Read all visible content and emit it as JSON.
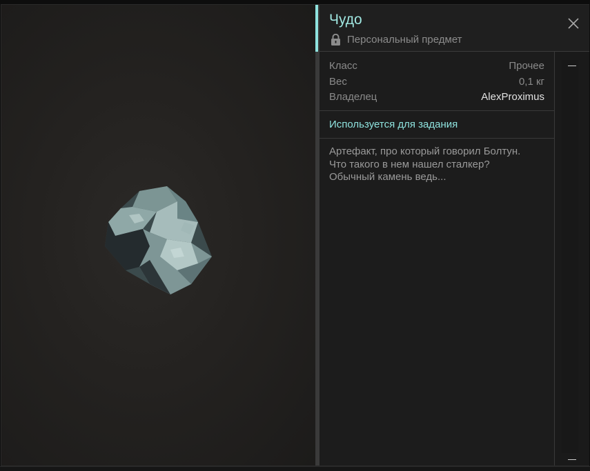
{
  "item": {
    "title": "Чудо",
    "subtitle": "Персональный предмет",
    "icon": "lock-icon"
  },
  "properties": [
    {
      "label": "Класс",
      "value": "Прочее"
    },
    {
      "label": "Вес",
      "value": "0,1 кг"
    },
    {
      "label": "Владелец",
      "value": "AlexProximus"
    }
  ],
  "quest_note": "Используется для задания",
  "description": [
    "Артефакт, про который говорил Болтун.",
    "Что такого в нем нашел сталкер?",
    "Обычный камень ведь..."
  ],
  "colors": {
    "accent": "#8fe3df",
    "panel_bg": "#1c1c1c",
    "preview_bg": "#242220"
  }
}
